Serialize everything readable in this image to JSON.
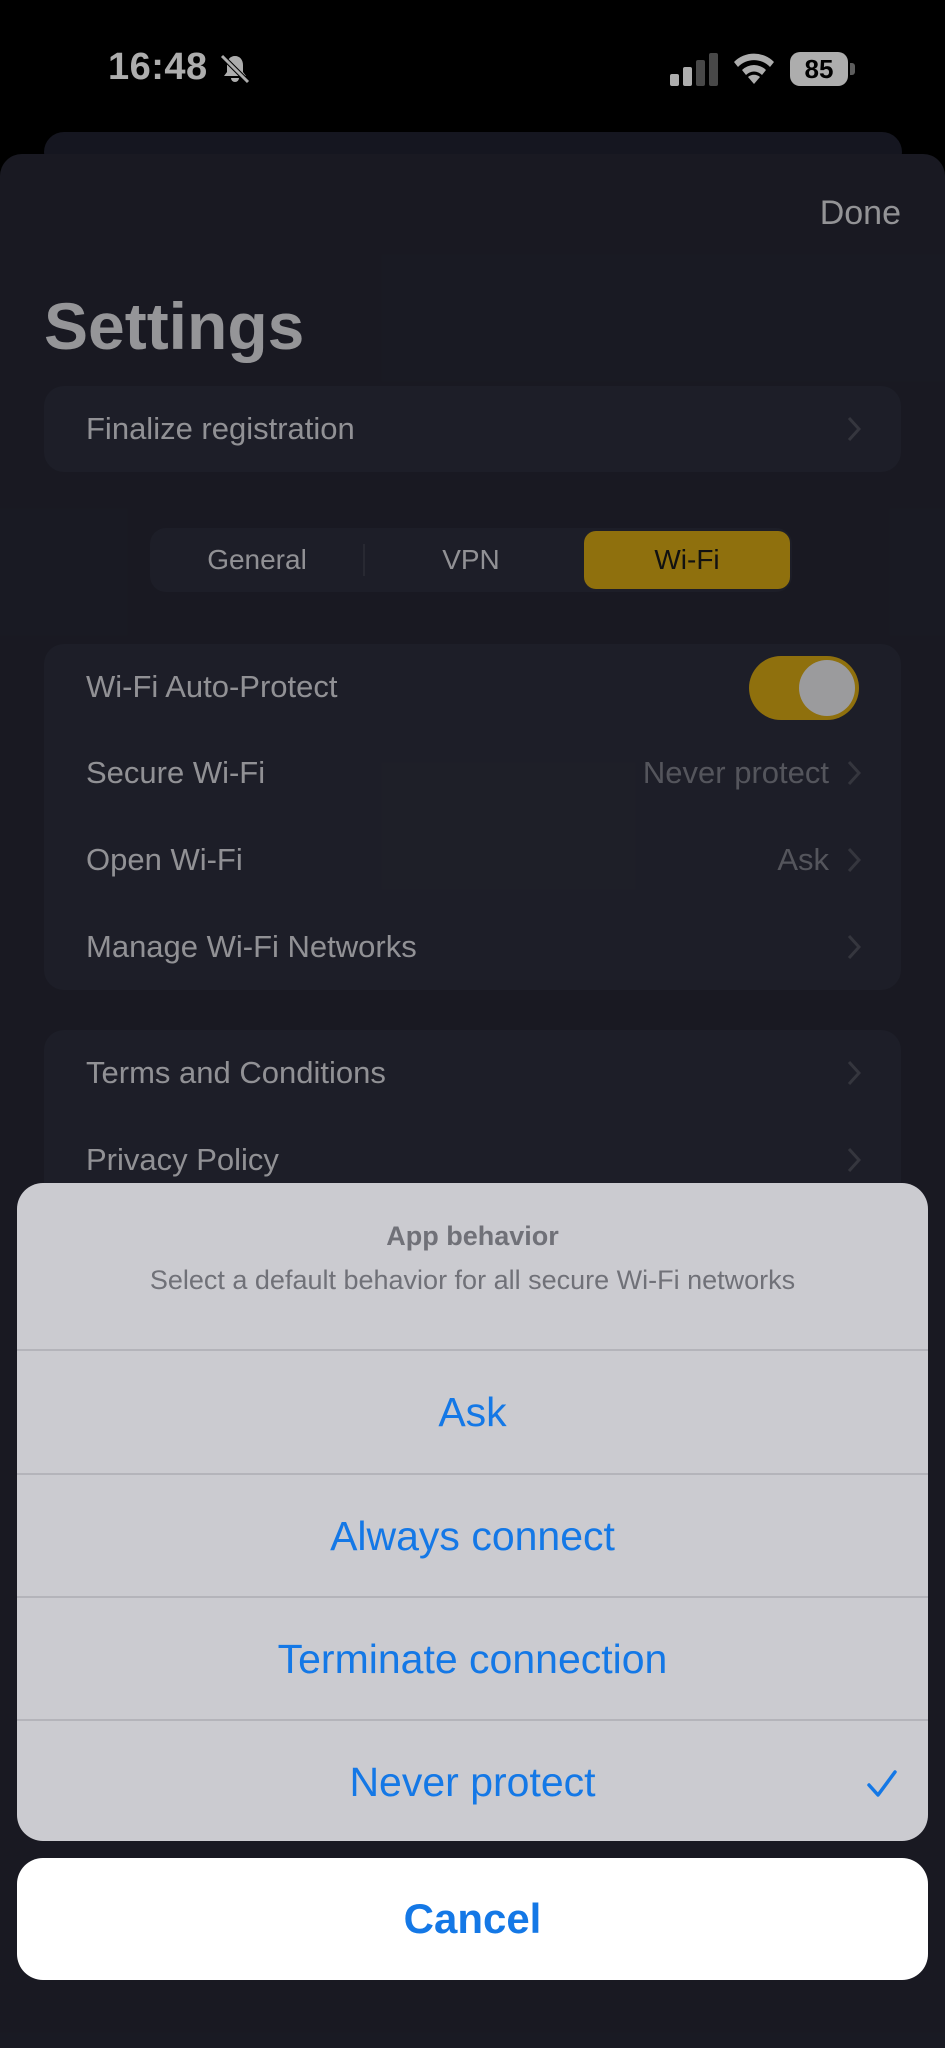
{
  "status_bar": {
    "time": "16:48",
    "battery": "85"
  },
  "header": {
    "done_label": "Done",
    "title": "Settings"
  },
  "registration": {
    "label": "Finalize registration"
  },
  "segments": {
    "items": [
      "General",
      "VPN",
      "Wi-Fi"
    ],
    "selected": "Wi-Fi"
  },
  "wifi_settings": {
    "auto_protect": {
      "label": "Wi-Fi Auto-Protect",
      "on": true
    },
    "secure_wifi": {
      "label": "Secure Wi-Fi",
      "value": "Never protect"
    },
    "open_wifi": {
      "label": "Open Wi-Fi",
      "value": "Ask"
    },
    "manage_networks": {
      "label": "Manage Wi-Fi Networks"
    }
  },
  "legal": {
    "terms": "Terms and Conditions",
    "privacy": "Privacy Policy"
  },
  "action_sheet": {
    "title": "App behavior",
    "message": "Select a default behavior for all secure Wi-Fi networks",
    "options": [
      "Ask",
      "Always connect",
      "Terminate connection",
      "Never protect"
    ],
    "selected": "Never protect",
    "cancel_label": "Cancel"
  },
  "colors": {
    "accent": "#d3a514",
    "ios_blue": "#1478e6",
    "sheet_bg": "#252633",
    "card_bg": "#2c2d3b"
  },
  "icons": [
    "bell-slash-icon",
    "cellular-signal-icon",
    "wifi-icon",
    "battery-icon",
    "chevron-right-icon",
    "checkmark-icon"
  ]
}
